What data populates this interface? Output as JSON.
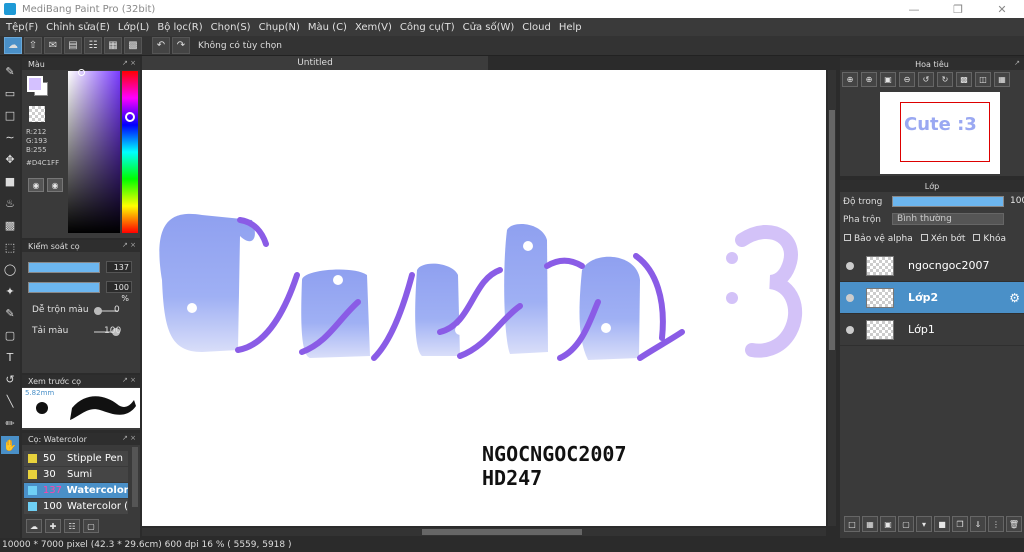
{
  "window": {
    "title": "MediBang Paint Pro (32bit)"
  },
  "menu": [
    "Tệp(F)",
    "Chỉnh sửa(E)",
    "Lớp(L)",
    "Bộ lọc(R)",
    "Chọn(S)",
    "Chụp(N)",
    "Màu (C)",
    "Xem(V)",
    "Công cụ(T)",
    "Cửa số(W)",
    "Cloud",
    "Help"
  ],
  "toolbar": {
    "option_label": "Không có tùy chọn"
  },
  "panels": {
    "color": {
      "title": "Màu",
      "r": "R:212",
      "g": "G:193",
      "b": "B:255",
      "hex": "#D4C1FF",
      "fg_color": "#D4C1FF"
    },
    "brush_control": {
      "title": "Kiểm soát cọ",
      "size": "137",
      "opacity": "100 %",
      "blend_label": "Dễ trộn màu",
      "blend_value": "0",
      "paint_label": "Tải màu",
      "paint_value": "100"
    },
    "preview": {
      "title": "Xem trước cọ",
      "size": "5.82mm"
    },
    "brush_list": {
      "title": "Cọ: Watercolor",
      "items": [
        {
          "num": "50",
          "name": "Stipple Pen",
          "color": "#e8d23c"
        },
        {
          "num": "30",
          "name": "Sumi",
          "color": "#e8d23c"
        },
        {
          "num": "137",
          "name": "Watercolor",
          "color": "#6fd0f5"
        },
        {
          "num": "100",
          "name": "Watercolor (",
          "color": "#6fd0f5"
        }
      ]
    },
    "navigator": {
      "title": "Hoa tiêu",
      "thumb_text": "Cute :3"
    },
    "layers": {
      "title": "Lớp",
      "opacity_label": "Độ trong",
      "opacity_value": "100",
      "blend_label": "Pha trộn",
      "blend_value": "Bình thường",
      "protect_alpha": "Bảo vệ alpha",
      "clipping": "Xén bớt",
      "lock": "Khóa",
      "items": [
        {
          "name": "ngocngoc2007"
        },
        {
          "name": "Lớp2"
        },
        {
          "name": "Lớp1"
        }
      ]
    }
  },
  "canvas": {
    "tab": "Untitled",
    "signature_line1": "NGOCNGOC2007",
    "signature_line2": "HD247"
  },
  "status": {
    "text": "10000 * 7000 pixel  (42.3 * 29.6cm)  600 dpi  16 %  ( 5559, 5918 )"
  }
}
